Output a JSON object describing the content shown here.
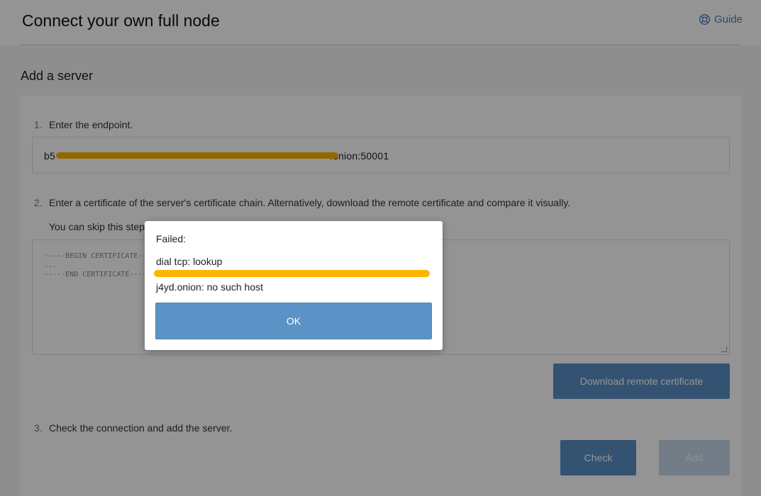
{
  "header": {
    "title": "Connect your own full node",
    "guide_label": "Guide"
  },
  "section_title": "Add a server",
  "steps": [
    {
      "num": "1.",
      "label": "Enter the endpoint."
    },
    {
      "num": "2.",
      "label": "Enter a certificate of the server's certificate chain. Alternatively, download the remote certificate and compare it visually."
    },
    {
      "num": "3.",
      "label": "Check the connection and add the server."
    }
  ],
  "step2_hint": "You can skip this step",
  "endpoint": {
    "value_prefix": "b5",
    "value_suffix": ".onion:50001"
  },
  "certificate": {
    "placeholder": "-----BEGIN CERTIFICATE-----\n...\n-----END CERTIFICATE-----"
  },
  "buttons": {
    "download": "Download remote certificate",
    "check": "Check",
    "add": "Add"
  },
  "dialog": {
    "title": "Failed:",
    "line1": "dial tcp: lookup",
    "line2": "j4yd.onion: no such host",
    "ok_label": "OK"
  },
  "colors": {
    "accent": "#5b90c4",
    "redaction": "#ffb400",
    "guide": "#4a7fc0"
  },
  "icons": {
    "guide": "lifebuoy-icon"
  }
}
